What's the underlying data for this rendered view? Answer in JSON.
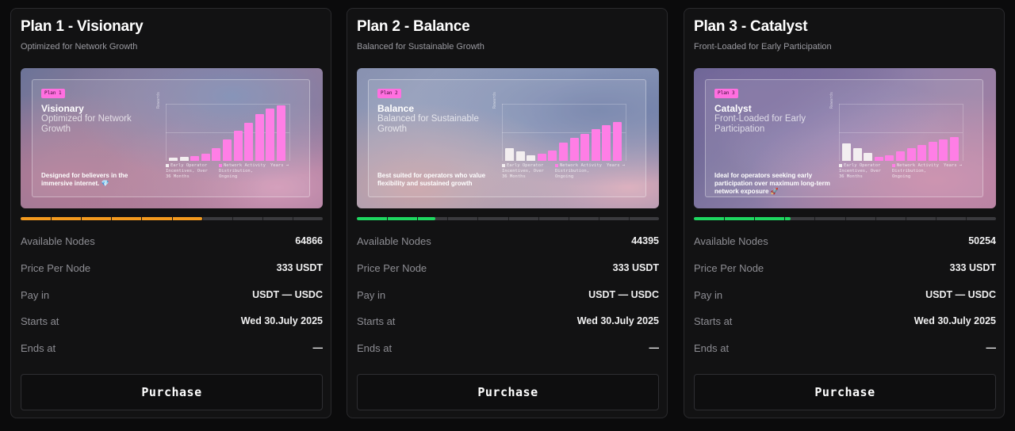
{
  "plans": [
    {
      "title": "Plan 1 - Visionary",
      "subtitle": "Optimized for Network Growth",
      "tag": "Plan 1",
      "banner_title": "Visionary",
      "banner_subtitle": "Optimized for Network Growth",
      "banner_description": "Designed for believers in the immersive internet.",
      "banner_emoji": "💎",
      "chart_axis_label": "Rewards",
      "legend": [
        "Early Operator Incentives, Over 36 Months",
        "Network Activity Distribution, Ongoing",
        "Years →"
      ],
      "bars": [
        {
          "kind": "white",
          "value": 0.06
        },
        {
          "kind": "white",
          "value": 0.07
        },
        {
          "kind": "pink",
          "value": 0.08
        },
        {
          "kind": "pink",
          "value": 0.12
        },
        {
          "kind": "pink",
          "value": 0.22
        },
        {
          "kind": "pink",
          "value": 0.37
        },
        {
          "kind": "pink",
          "value": 0.53
        },
        {
          "kind": "pink",
          "value": 0.66
        },
        {
          "kind": "pink",
          "value": 0.82
        },
        {
          "kind": "pink",
          "value": 0.92
        },
        {
          "kind": "pink",
          "value": 0.97
        }
      ],
      "progress_fraction": 0.6,
      "progress_color": "#f39a1e",
      "available_nodes_label": "Available Nodes",
      "available_nodes": "64866",
      "price_label": "Price Per Node",
      "price": "333 USDT",
      "pay_label": "Pay in",
      "pay": "USDT — USDC",
      "starts_label": "Starts at",
      "starts": "Wed 30.July 2025",
      "ends_label": "Ends at",
      "ends": "—",
      "button_label": "Purchase"
    },
    {
      "title": "Plan 2 - Balance",
      "subtitle": "Balanced for Sustainable Growth",
      "tag": "Plan 2",
      "banner_title": "Balance",
      "banner_subtitle": "Balanced for Sustainable Growth",
      "banner_description": "Best suited for operators who value flexibility and sustained growth",
      "banner_emoji": "",
      "chart_axis_label": "Rewards",
      "legend": [
        "Early Operator Incentives, Over 36 Months",
        "Network Activity Distribution, Ongoing",
        "Years →"
      ],
      "bars": [
        {
          "kind": "white",
          "value": 0.22
        },
        {
          "kind": "white",
          "value": 0.16
        },
        {
          "kind": "white",
          "value": 0.1
        },
        {
          "kind": "pink",
          "value": 0.12
        },
        {
          "kind": "pink",
          "value": 0.18
        },
        {
          "kind": "pink",
          "value": 0.32
        },
        {
          "kind": "pink",
          "value": 0.4
        },
        {
          "kind": "pink",
          "value": 0.47
        },
        {
          "kind": "pink",
          "value": 0.55
        },
        {
          "kind": "pink",
          "value": 0.62
        },
        {
          "kind": "pink",
          "value": 0.68
        }
      ],
      "progress_fraction": 0.26,
      "progress_color": "#1ed760",
      "available_nodes_label": "Available Nodes",
      "available_nodes": "44395",
      "price_label": "Price Per Node",
      "price": "333 USDT",
      "pay_label": "Pay in",
      "pay": "USDT — USDC",
      "starts_label": "Starts at",
      "starts": "Wed 30.July 2025",
      "ends_label": "Ends at",
      "ends": "—",
      "button_label": "Purchase"
    },
    {
      "title": "Plan 3 - Catalyst",
      "subtitle": "Front-Loaded for Early Participation",
      "tag": "Plan 3",
      "banner_title": "Catalyst",
      "banner_subtitle": "Front-Loaded for Early Participation",
      "banner_description": "Ideal for operators seeking early participation over maximum long-term network exposure",
      "banner_emoji": "🚀",
      "chart_axis_label": "Rewards",
      "legend": [
        "Early Operator Incentives, Over 36 Months",
        "Network Activity Distribution, Ongoing",
        "Years →"
      ],
      "bars": [
        {
          "kind": "white",
          "value": 0.3
        },
        {
          "kind": "white",
          "value": 0.22
        },
        {
          "kind": "white",
          "value": 0.14
        },
        {
          "kind": "pink",
          "value": 0.07
        },
        {
          "kind": "pink",
          "value": 0.1
        },
        {
          "kind": "pink",
          "value": 0.16
        },
        {
          "kind": "pink",
          "value": 0.22
        },
        {
          "kind": "pink",
          "value": 0.28
        },
        {
          "kind": "pink",
          "value": 0.34
        },
        {
          "kind": "pink",
          "value": 0.38
        },
        {
          "kind": "pink",
          "value": 0.42
        }
      ],
      "progress_fraction": 0.32,
      "progress_color": "#1ed760",
      "available_nodes_label": "Available Nodes",
      "available_nodes": "50254",
      "price_label": "Price Per Node",
      "price": "333 USDT",
      "pay_label": "Pay in",
      "pay": "USDT — USDC",
      "starts_label": "Starts at",
      "starts": "Wed 30.July 2025",
      "ends_label": "Ends at",
      "ends": "—",
      "button_label": "Purchase"
    }
  ]
}
